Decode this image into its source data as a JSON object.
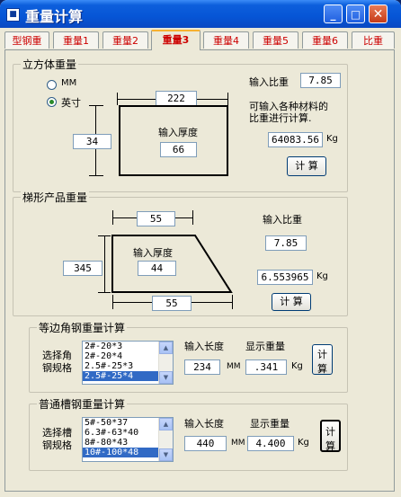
{
  "window": {
    "title": "重量计算",
    "min_label": "_",
    "max_label": "□",
    "close_label": "✕"
  },
  "tabs": [
    "型钢重",
    "重量1",
    "重量2",
    "重量3",
    "重量4",
    "重量5",
    "重量6",
    "比重"
  ],
  "active_tab": "重量3",
  "cube": {
    "group_label": "立方体重量",
    "unit_mm": "MM",
    "unit_inch": "英寸",
    "selected_unit": "英寸",
    "width": "222",
    "height": "34",
    "thickness_label": "输入厚度",
    "thickness": "66",
    "density_label": "输入比重",
    "density": "7.85",
    "hint_line1": "可输入各种材料的",
    "hint_line2": "比重进行计算.",
    "result": "64083.56",
    "result_unit": "Kg",
    "calc_label": "计 算"
  },
  "trapezoid": {
    "group_label": "梯形产品重量",
    "top_width": "55",
    "height": "345",
    "thickness_label": "输入厚度",
    "thickness": "44",
    "bottom_width": "55",
    "density_label": "输入比重",
    "density": "7.85",
    "result": "6.553965",
    "result_unit": "Kg",
    "calc_label": "计 算"
  },
  "angle": {
    "group_label": "等边角钢重量计算",
    "select_label_1": "选择角",
    "select_label_2": "钢规格",
    "items": [
      "2#-20*3",
      "2#-20*4",
      "2.5#-25*3",
      "2.5#-25*4"
    ],
    "selected_index": 3,
    "length_label": "输入长度",
    "length": "234",
    "length_unit": "MM",
    "display_label": "显示重量",
    "weight": ".341",
    "weight_unit": "Kg",
    "calc_label_1": "计",
    "calc_label_2": "算"
  },
  "channel": {
    "group_label": "普通槽钢重量计算",
    "select_label_1": "选择槽",
    "select_label_2": "钢规格",
    "items": [
      "5#-50*37",
      "6.3#-63*40",
      "8#-80*43",
      "10#-100*48"
    ],
    "selected_index": 3,
    "length_label": "输入长度",
    "length": "440",
    "length_unit": "MM",
    "display_label": "显示重量",
    "weight": "4.400",
    "weight_unit": "Kg",
    "calc_label_1": "计",
    "calc_label_2": "算"
  }
}
